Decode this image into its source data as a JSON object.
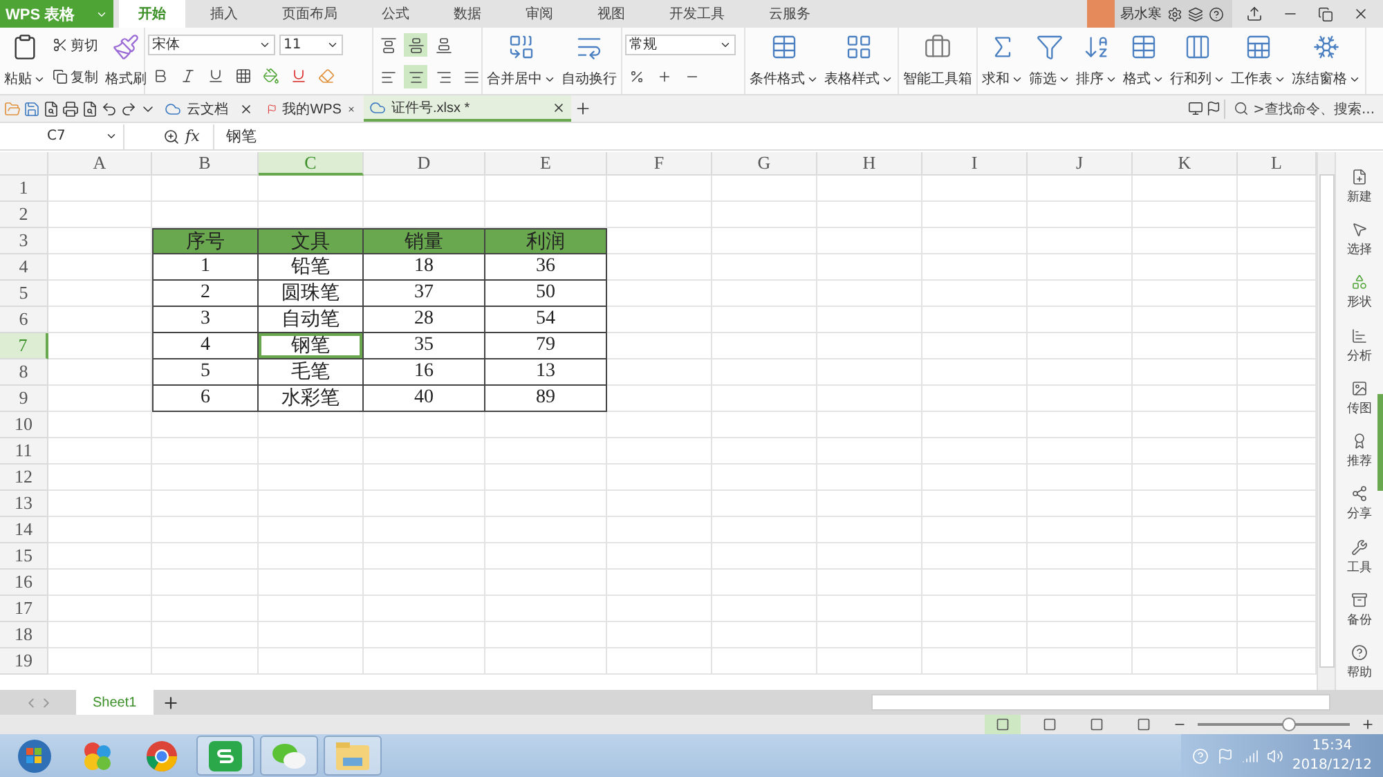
{
  "app": {
    "menu_button": "WPS 表格",
    "user": "易水寒"
  },
  "ribbon_tabs": [
    {
      "label": "开始",
      "selected": true
    },
    {
      "label": "插入",
      "selected": false
    },
    {
      "label": "页面布局",
      "selected": false
    },
    {
      "label": "公式",
      "selected": false
    },
    {
      "label": "数据",
      "selected": false
    },
    {
      "label": "审阅",
      "selected": false
    },
    {
      "label": "视图",
      "selected": false
    },
    {
      "label": "开发工具",
      "selected": false
    },
    {
      "label": "云服务",
      "selected": false
    }
  ],
  "ribbon": {
    "paste": "粘贴",
    "cut": "剪切",
    "copy": "复制",
    "format_painter": "格式刷",
    "font_name": "宋体",
    "font_size": "11",
    "vertical_align": [
      {
        "selected": false
      },
      {
        "selected": true
      },
      {
        "selected": false
      }
    ],
    "horizontal_align": [
      {
        "selected": false
      },
      {
        "selected": true
      },
      {
        "selected": false
      },
      {
        "selected": false
      }
    ],
    "align_buttons": [
      {
        "label": "合并居中",
        "kind": "merge",
        "dropdown": true
      },
      {
        "label": "自动换行",
        "kind": "wrap",
        "dropdown": false
      }
    ],
    "number_format": "常规",
    "style_buttons": [
      {
        "label": "条件格式",
        "kind": "conditional",
        "dropdown": true
      },
      {
        "label": "表格样式",
        "kind": "style",
        "dropdown": true
      }
    ],
    "toolbox": "智能工具箱",
    "edit_buttons": [
      {
        "label": "求和",
        "kind": "sum",
        "dropdown": true
      },
      {
        "label": "筛选",
        "kind": "filter",
        "dropdown": true
      },
      {
        "label": "排序",
        "kind": "sort",
        "dropdown": true
      },
      {
        "label": "格式",
        "kind": "format",
        "dropdown": true
      },
      {
        "label": "行和列",
        "kind": "rowcol",
        "dropdown": true
      },
      {
        "label": "工作表",
        "kind": "sheet",
        "dropdown": true
      },
      {
        "label": "冻结窗格",
        "kind": "freeze",
        "dropdown": true
      }
    ]
  },
  "doc_tabs": [
    {
      "label": "云文档",
      "kind": "cloud",
      "selected": false
    },
    {
      "label": "我的WPS",
      "kind": "wps",
      "selected": false
    },
    {
      "label": "证件号.xlsx *",
      "kind": "sheet",
      "selected": true
    }
  ],
  "search": {
    "placeholder": ">查找命令、搜索..."
  },
  "formula_bar": {
    "cell_ref": "C7",
    "fx": "fx",
    "value": "钢笔"
  },
  "sheet": {
    "columns": [
      {
        "label": "A",
        "selected": false
      },
      {
        "label": "B",
        "selected": false
      },
      {
        "label": "C",
        "selected": true
      },
      {
        "label": "D",
        "selected": false
      },
      {
        "label": "E",
        "selected": false
      },
      {
        "label": "F",
        "selected": false
      },
      {
        "label": "G",
        "selected": false
      },
      {
        "label": "H",
        "selected": false
      },
      {
        "label": "I",
        "selected": false
      },
      {
        "label": "J",
        "selected": false
      },
      {
        "label": "K",
        "selected": false
      },
      {
        "label": "L",
        "selected": false
      }
    ],
    "rows": [
      {
        "label": "1",
        "selected": false
      },
      {
        "label": "2",
        "selected": false
      },
      {
        "label": "3",
        "selected": false
      },
      {
        "label": "4",
        "selected": false
      },
      {
        "label": "5",
        "selected": false
      },
      {
        "label": "6",
        "selected": false
      },
      {
        "label": "7",
        "selected": true
      },
      {
        "label": "8",
        "selected": false
      },
      {
        "label": "9",
        "selected": false
      },
      {
        "label": "10",
        "selected": false
      },
      {
        "label": "11",
        "selected": false
      },
      {
        "label": "12",
        "selected": false
      },
      {
        "label": "13",
        "selected": false
      },
      {
        "label": "14",
        "selected": false
      },
      {
        "label": "15",
        "selected": false
      },
      {
        "label": "16",
        "selected": false
      },
      {
        "label": "17",
        "selected": false
      },
      {
        "label": "18",
        "selected": false
      },
      {
        "label": "19",
        "selected": false
      }
    ],
    "table": {
      "header": [
        "序号",
        "文具",
        "销量",
        "利润"
      ],
      "rows": [
        {
          "cells": [
            {
              "text": "1",
              "selected": false
            },
            {
              "text": "铅笔",
              "selected": false
            },
            {
              "text": "18",
              "selected": false
            },
            {
              "text": "36",
              "selected": false
            }
          ]
        },
        {
          "cells": [
            {
              "text": "2",
              "selected": false
            },
            {
              "text": "圆珠笔",
              "selected": false
            },
            {
              "text": "37",
              "selected": false
            },
            {
              "text": "50",
              "selected": false
            }
          ]
        },
        {
          "cells": [
            {
              "text": "3",
              "selected": false
            },
            {
              "text": "自动笔",
              "selected": false
            },
            {
              "text": "28",
              "selected": false
            },
            {
              "text": "54",
              "selected": false
            }
          ]
        },
        {
          "cells": [
            {
              "text": "4",
              "selected": false
            },
            {
              "text": "钢笔",
              "selected": true
            },
            {
              "text": "35",
              "selected": false
            },
            {
              "text": "79",
              "selected": false
            }
          ]
        },
        {
          "cells": [
            {
              "text": "5",
              "selected": false
            },
            {
              "text": "毛笔",
              "selected": false
            },
            {
              "text": "16",
              "selected": false
            },
            {
              "text": "13",
              "selected": false
            }
          ]
        },
        {
          "cells": [
            {
              "text": "6",
              "selected": false
            },
            {
              "text": "水彩笔",
              "selected": false
            },
            {
              "text": "40",
              "selected": false
            },
            {
              "text": "89",
              "selected": false
            }
          ]
        }
      ]
    }
  },
  "sheet_tabs": [
    {
      "label": "Sheet1",
      "selected": true
    }
  ],
  "sidebar": [
    {
      "label": "新建",
      "kind": "new"
    },
    {
      "label": "选择",
      "kind": "select"
    },
    {
      "label": "形状",
      "kind": "shape"
    },
    {
      "label": "分析",
      "kind": "analysis"
    },
    {
      "label": "传图",
      "kind": "image"
    },
    {
      "label": "推荐",
      "kind": "award"
    },
    {
      "label": "分享",
      "kind": "share"
    },
    {
      "label": "工具",
      "kind": "tools"
    },
    {
      "label": "备份",
      "kind": "backup"
    },
    {
      "label": "帮助",
      "kind": "help"
    }
  ],
  "status_bar": {
    "views": [
      {
        "selected": true
      },
      {
        "selected": false
      },
      {
        "selected": false
      },
      {
        "selected": false
      }
    ],
    "zoom": {
      "level": 0.6
    }
  },
  "taskbar": {
    "apps": [
      {
        "kind": "start",
        "running": false
      },
      {
        "kind": "pinwheel",
        "running": false
      },
      {
        "kind": "chrome",
        "running": false
      },
      {
        "kind": "wps",
        "running": true
      },
      {
        "kind": "wechat",
        "running": true
      },
      {
        "kind": "explorer",
        "running": true
      }
    ],
    "clock": {
      "time": "15:34",
      "date": "2018/12/12"
    }
  }
}
